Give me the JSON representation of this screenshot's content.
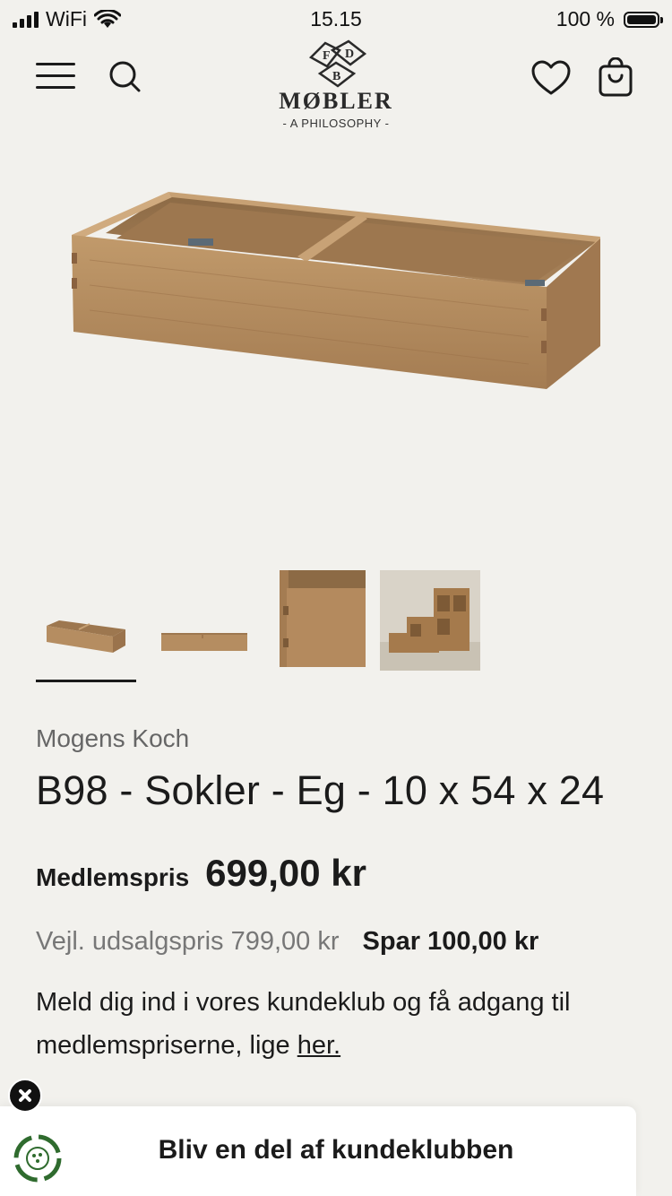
{
  "status_bar": {
    "carrier": "WiFi",
    "time": "15.15",
    "battery": "100 %"
  },
  "header": {
    "brand": "MØBLER",
    "tagline": "- A PHILOSOPHY -",
    "logo_letters": [
      "F",
      "D",
      "B"
    ]
  },
  "product": {
    "designer": "Mogens Koch",
    "title": "B98 - Sokler - Eg - 10 x 54 x 24",
    "member_label": "Medlemspris",
    "member_price": "699,00 kr",
    "rrp": "Vejl. udsalgspris 799,00 kr",
    "save": "Spar 100,00 kr",
    "club_text": "Meld dig ind i vores kundeklub og få adgang til medlemspriserne, lige ",
    "club_link": "her."
  },
  "gallery": {
    "thumbnail_count": 4,
    "selected_index": 0
  },
  "club_banner": {
    "label": "Bliv en del af kundeklubben"
  },
  "colors": {
    "background": "#f2f1ed",
    "text": "#1b1b1b",
    "muted": "#777777",
    "wood": "#b08a5e",
    "badge_green": "#2f6b2e"
  }
}
